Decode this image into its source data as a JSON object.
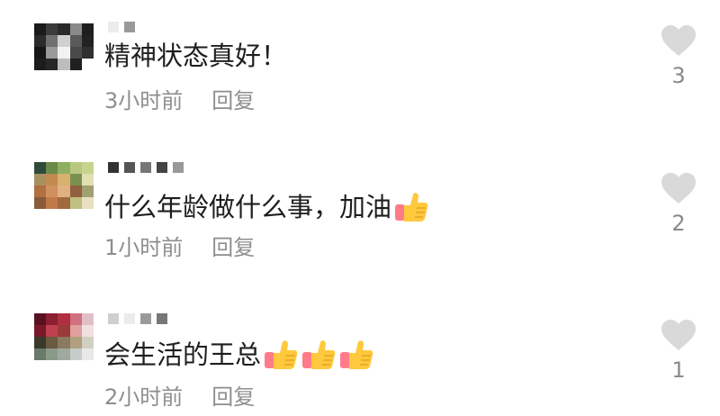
{
  "comments": [
    {
      "text": "精神状态真好！",
      "time": "3小时前",
      "reply": "回复",
      "likes": "3",
      "emoji_count": 0,
      "avatar_colors": [
        "#1a1a1a",
        "#3b3b3b",
        "#2a2a2a",
        "#8a8a8a",
        "#1e1e1e",
        "#2b2b2b",
        "#707070",
        "#d0d0d0",
        "#5a5a5a",
        "#222222",
        "#161616",
        "#9a9a9a",
        "#f2f2f2",
        "#4a4a4a",
        "#303030",
        "#1c1c1c",
        "#262626",
        "#bdbdbd",
        "#202020",
        "#ffffff"
      ],
      "username_colors": [
        "#ececec",
        "#9a9a9a"
      ]
    },
    {
      "text": "什么年龄做什么事，加油",
      "time": "1小时前",
      "reply": "回复",
      "likes": "2",
      "emoji_count": 1,
      "avatar_colors": [
        "#2e4a3a",
        "#6a8a4a",
        "#8fb060",
        "#b8c880",
        "#c7d48e",
        "#a89060",
        "#c08a50",
        "#d8b070",
        "#7a9050",
        "#e0e0b0",
        "#b07040",
        "#d09060",
        "#e0b080",
        "#906040",
        "#a0a070",
        "#8a5a3a",
        "#c07a4a",
        "#a06a40",
        "#c0c080",
        "#e8e0c0"
      ],
      "username_colors": [
        "#333333",
        "#555555",
        "#777777",
        "#444444",
        "#999999"
      ]
    },
    {
      "text": "会生活的王总",
      "time": "2小时前",
      "reply": "回复",
      "likes": "1",
      "emoji_count": 3,
      "avatar_colors": [
        "#5a1020",
        "#8a2030",
        "#b03040",
        "#d07080",
        "#e0c0c8",
        "#7a1828",
        "#c04050",
        "#9a3a3a",
        "#e0a0a0",
        "#f0e0e0",
        "#3a3a2a",
        "#6a5a40",
        "#8a7a60",
        "#b0a080",
        "#d0d0c0",
        "#6a7a6a",
        "#8a9a8a",
        "#a0a8a0",
        "#c8ccc8",
        "#e8e8e8"
      ],
      "username_colors": [
        "#cfcfcf",
        "#ececec",
        "#9a9a9a",
        "#777777"
      ]
    }
  ],
  "colors": {
    "text": "#1e1e1e",
    "meta": "#8e8e8e",
    "heart": "#d9d9d9",
    "thumb": "#ffc83d",
    "cuff": "#ff7b8a"
  },
  "icons": {
    "like": "heart-icon",
    "emoji": "thumbs-up-emoji"
  }
}
